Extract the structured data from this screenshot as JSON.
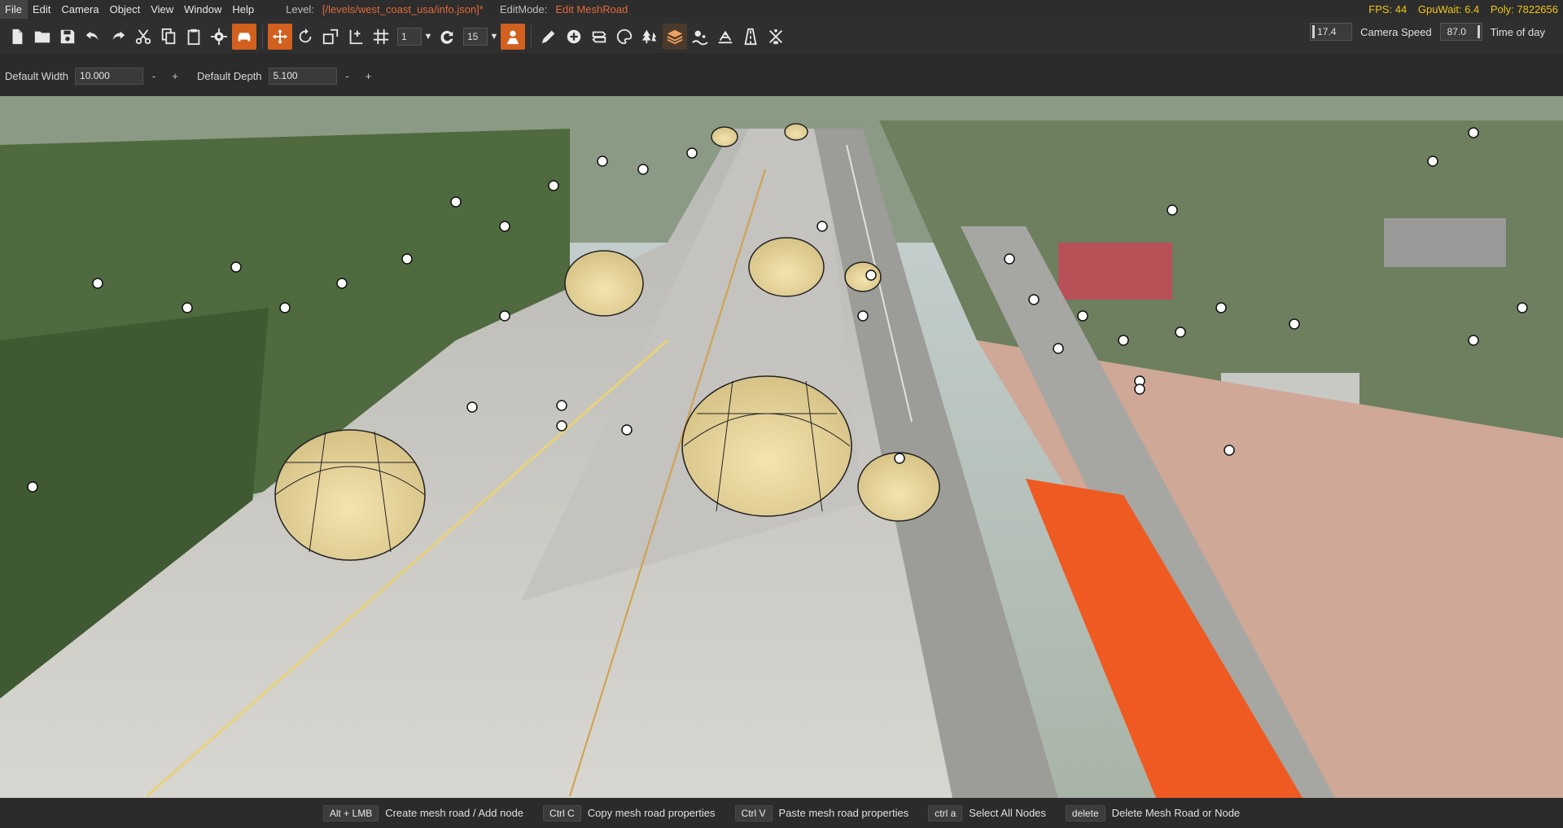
{
  "menubar": {
    "items": [
      "File",
      "Edit",
      "Camera",
      "Object",
      "View",
      "Window",
      "Help"
    ],
    "level_label": "Level:",
    "level_path": "[/levels/west_coast_usa/info.json]*",
    "editmode_label": "EditMode:",
    "editmode_value": "Edit MeshRoad",
    "stats": {
      "fps": "FPS: 44",
      "gpu": "GpuWait: 6.4",
      "poly": "Poly: 7822656"
    }
  },
  "toolbar": {
    "snap_value": "1",
    "rotate_snap_value": "15",
    "camera_speed_value": "17.4",
    "camera_speed_label": "Camera Speed",
    "time_of_day_value": "87.0",
    "time_of_day_label": "Time of day",
    "icons": [
      "new-file-icon",
      "open-folder-icon",
      "save-icon",
      "undo-icon",
      "redo-icon",
      "cut-icon",
      "copy-icon",
      "paste-icon",
      "settings-gear-icon",
      "vehicle-icon",
      "translate-icon",
      "rotate-icon",
      "scale-icon",
      "snap-axis-icon",
      "grid-snap-icon",
      "rotate-snap-icon",
      "terrain-editor-icon",
      "pencil-icon",
      "add-node-icon",
      "road-editor-icon",
      "paint-icon",
      "forest-icon",
      "mesh-road-icon",
      "river-icon",
      "terrain-painter-icon",
      "decal-road-icon",
      "sketch-icon"
    ],
    "accent_color": "#d2601f"
  },
  "propbar": {
    "default_width_label": "Default Width",
    "default_width_value": "10.000",
    "default_depth_label": "Default Depth",
    "default_depth_value": "5.100",
    "minus": "-",
    "plus": "+"
  },
  "statusbar": {
    "hints": [
      {
        "key": "Alt + LMB",
        "text": "Create mesh road / Add node"
      },
      {
        "key": "Ctrl C",
        "text": "Copy mesh road properties"
      },
      {
        "key": "Ctrl V",
        "text": "Paste mesh road properties"
      },
      {
        "key": "ctrl a",
        "text": "Select All Nodes"
      },
      {
        "key": "delete",
        "text": "Delete Mesh Road or Node"
      }
    ]
  }
}
